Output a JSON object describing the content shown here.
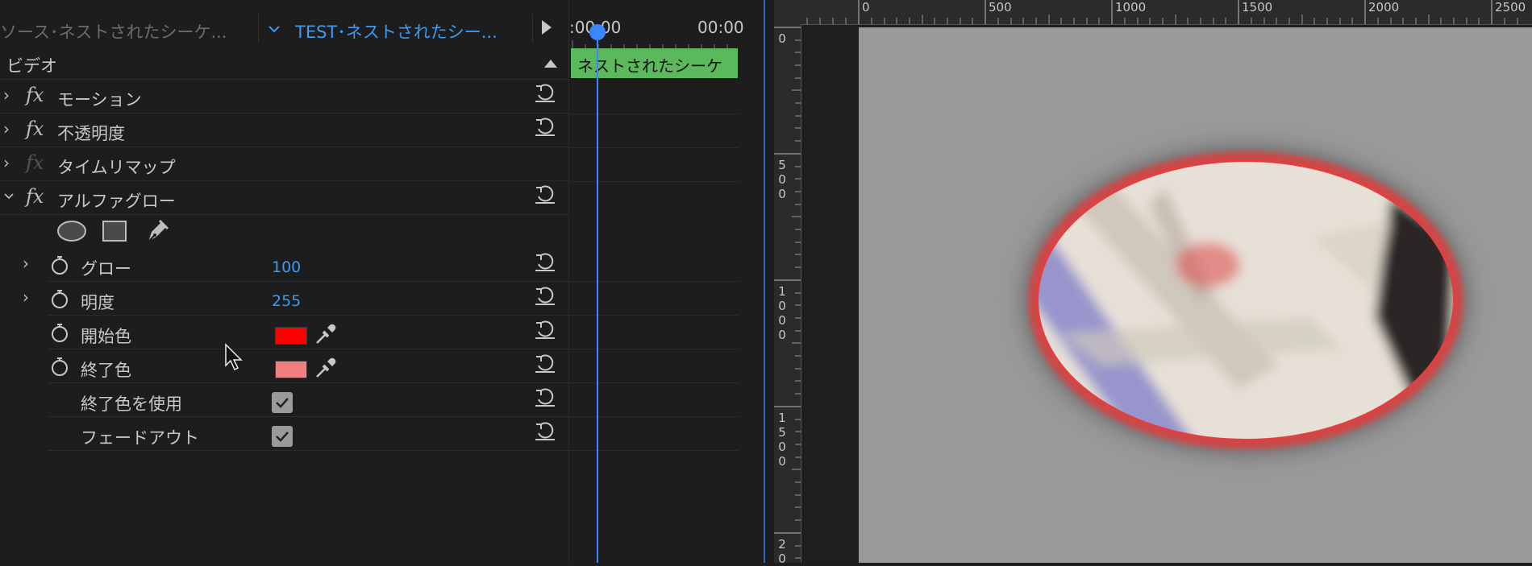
{
  "effect_controls": {
    "source_label": "ソース･ネストされたシーケ...",
    "sequence_label": "TEST･ネストされたシー...",
    "video_section": "ビデオ",
    "effects": [
      {
        "label": "モーション",
        "expanded": false,
        "enabled": true
      },
      {
        "label": "不透明度",
        "expanded": false,
        "enabled": true
      },
      {
        "label": "タイムリマップ",
        "expanded": false,
        "enabled": false
      },
      {
        "label": "アルファグロー",
        "expanded": true,
        "enabled": true
      }
    ],
    "params": {
      "glow": {
        "label": "グロー",
        "value": "100"
      },
      "brightness": {
        "label": "明度",
        "value": "255"
      },
      "start_color": {
        "label": "開始色",
        "color": "#ff0000"
      },
      "end_color": {
        "label": "終了色",
        "color": "#f08080"
      },
      "use_end_color": {
        "label": "終了色を使用",
        "checked": true
      },
      "fade_out": {
        "label": "フェードアウト",
        "checked": true
      }
    },
    "fx_symbol": "fx"
  },
  "timeline": {
    "start_time": ":00:00",
    "end_time": "00:00",
    "clip_label": "ネストされたシーケ",
    "clip_color": "#5cb85c",
    "playhead_color": "#3a86ff"
  },
  "monitor": {
    "ruler_top": [
      "0",
      "500",
      "1000",
      "1500",
      "2000",
      "2500"
    ],
    "ruler_left": [
      "0",
      "500",
      "1000",
      "1500",
      "20"
    ],
    "canvas_color": "#999999",
    "glow_color": "#e04040"
  },
  "icons": [
    "chevron-down-icon",
    "play-icon",
    "collapse-triangle-icon",
    "reset-icon",
    "stopwatch-icon",
    "ellipse-mask-icon",
    "rectangle-mask-icon",
    "pen-mask-icon",
    "eyedropper-icon",
    "checkbox-icon",
    "mouse-cursor-icon"
  ]
}
